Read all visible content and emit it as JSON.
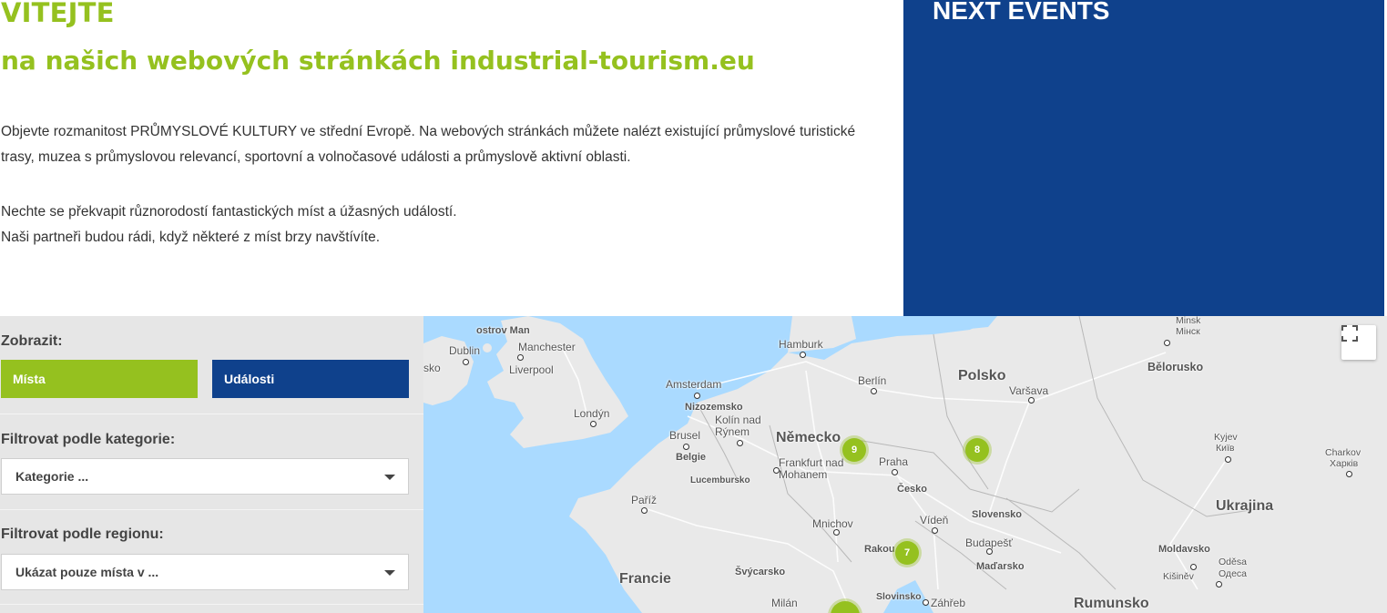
{
  "intro": {
    "title": "VITEJTE",
    "subtitle": "na našich webových stránkách industrial-tourism.eu",
    "paragraph1": "Objevte rozmanitost PRŮMYSLOVÉ KULTURY ve střední Evropě. Na webových stránkách můžete nalézt existující průmyslové turistické trasy, muzea s průmyslovou relevancí, sportovní a volnočasové události a průmyslově aktivní oblasti.",
    "paragraph2_line1": "Nechte se překvapit různorodostí fantastických míst a úžasných událostí.",
    "paragraph2_line2": "Naši partneři budou rádi, když některé z míst brzy navštívíte."
  },
  "events": {
    "title": "NEXT EVENTS"
  },
  "sidebar": {
    "show_label": "Zobrazit:",
    "places_button": "Místa",
    "events_button": "Události",
    "category_label": "Filtrovat podle kategorie:",
    "category_select": "Kategorie ...",
    "region_label": "Filtrovat podle regionu:",
    "region_select": "Ukázat pouze místa v ..."
  },
  "map": {
    "countries": [
      "Polsko",
      "Německo",
      "Bělorusko",
      "Ukrajina",
      "Francie",
      "Rumunsko",
      "Česko",
      "Slovensko",
      "Belgie",
      "Nizozemsko",
      "Lucembursko",
      "Švýcarsko",
      "Moldavsko"
    ],
    "cities": {
      "minsk": "Minsk",
      "minsk_local": "Мінск",
      "hamburk": "Hamburk",
      "berlin": "Berlín",
      "varsava": "Varšava",
      "amsterdam": "Amsterdam",
      "londyn": "Londýn",
      "dublin": "Dublin",
      "manchester": "Manchester",
      "liverpool": "Liverpool",
      "ostrov_man": "ostrov Man",
      "kolin": "Kolín nad Rýnem",
      "brusel": "Brusel",
      "frankfurt": "Frankfurt nad Mohanem",
      "praha": "Praha",
      "kyjev": "Kyjev",
      "kyjev_local": "Київ",
      "charkov": "Charkov",
      "charkov_local": "Харків",
      "pariz": "Paříž",
      "mnichov": "Mnichov",
      "viden": "Vídeň",
      "budapest": "Budapešť",
      "madarsko": "Maďarsko",
      "rakousko": "Rakou",
      "odesa": "Oděsa",
      "odesa_local": "Одеса",
      "kisinev": "Kišiněv",
      "milan": "Milán",
      "slovinsko": "Slovinsko",
      "zahreb": "Záhřeb",
      "sko": "sko"
    },
    "clusters": [
      {
        "id": "cluster-germany",
        "count": "9"
      },
      {
        "id": "cluster-poland",
        "count": "8"
      },
      {
        "id": "cluster-austria",
        "count": "7"
      }
    ]
  },
  "colors": {
    "green": "#95c11f",
    "blue": "#0f418c"
  }
}
